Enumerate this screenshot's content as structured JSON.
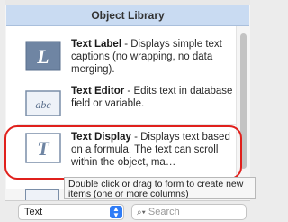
{
  "panel": {
    "title": "Object Library"
  },
  "items": [
    {
      "name": "Text Label",
      "description": " - Displays simple text captions (no wrapping, no data merging).",
      "icon_letter": "L",
      "icon": "text-label-icon"
    },
    {
      "name": "Text Editor",
      "description": " - Edits text in database field or variable.",
      "icon_letter": "abc",
      "icon": "text-editor-icon"
    },
    {
      "name": "Text Display",
      "description": " - Displays text based on a formula. The text can scroll within the object, ma…",
      "icon_letter": "T",
      "icon": "text-display-icon"
    }
  ],
  "tooltip": {
    "line1": "Double click or drag to form to create new",
    "line2": "items (one or more columns)"
  },
  "bottom": {
    "filter_value": "Text",
    "search_placeholder": "Search",
    "search_icon": "magnifier-with-dropdown"
  },
  "colors": {
    "accent": "#2f7cf6",
    "highlight": "#e0201c",
    "header_bg": "#c9dbf2"
  }
}
